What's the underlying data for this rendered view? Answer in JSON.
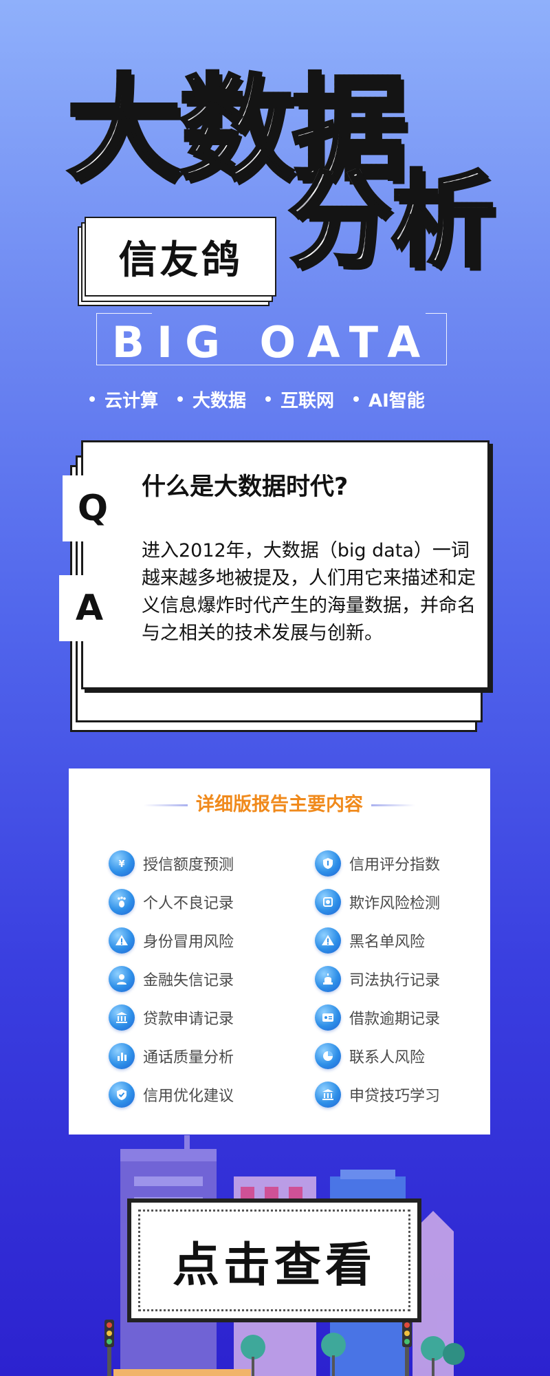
{
  "header": {
    "title_main": "大数据",
    "title_sub": "分析",
    "brand": "信友鸽",
    "english_title": "BIG OATA",
    "tags": [
      "云计算",
      "大数据",
      "互联网",
      "AI智能"
    ]
  },
  "qa": {
    "q_label": "Q",
    "a_label": "A",
    "question": "什么是大数据时代?",
    "answer": "进入2012年，大数据（big data）一词越来越多地被提及，人们用它来描述和定义信息爆炸时代产生的海量数据，并命名与之相关的技术发展与创新。"
  },
  "report": {
    "title": "详细版报告主要内容",
    "title_color": "#f08a1c",
    "items": [
      {
        "label": "授信额度预测",
        "icon": "yen-icon"
      },
      {
        "label": "信用评分指数",
        "icon": "shield-icon"
      },
      {
        "label": "个人不良记录",
        "icon": "footprint-icon"
      },
      {
        "label": "欺诈风险检测",
        "icon": "scan-icon"
      },
      {
        "label": "身份冒用风险",
        "icon": "warning-icon"
      },
      {
        "label": "黑名单风险",
        "icon": "warning-icon"
      },
      {
        "label": "金融失信记录",
        "icon": "person-icon"
      },
      {
        "label": "司法执行记录",
        "icon": "alarm-icon"
      },
      {
        "label": "贷款申请记录",
        "icon": "bank-icon"
      },
      {
        "label": "借款逾期记录",
        "icon": "id-card-icon"
      },
      {
        "label": "通话质量分析",
        "icon": "bar-chart-icon"
      },
      {
        "label": "联系人风险",
        "icon": "pie-chart-icon"
      },
      {
        "label": "信用优化建议",
        "icon": "check-shield-icon"
      },
      {
        "label": "申贷技巧学习",
        "icon": "bank-icon"
      }
    ]
  },
  "cta": {
    "label": "点击查看"
  },
  "colors": {
    "bg_top": "#8fb0fb",
    "bg_bottom": "#2c22cf",
    "icon_blue": "#2e8fe8"
  }
}
